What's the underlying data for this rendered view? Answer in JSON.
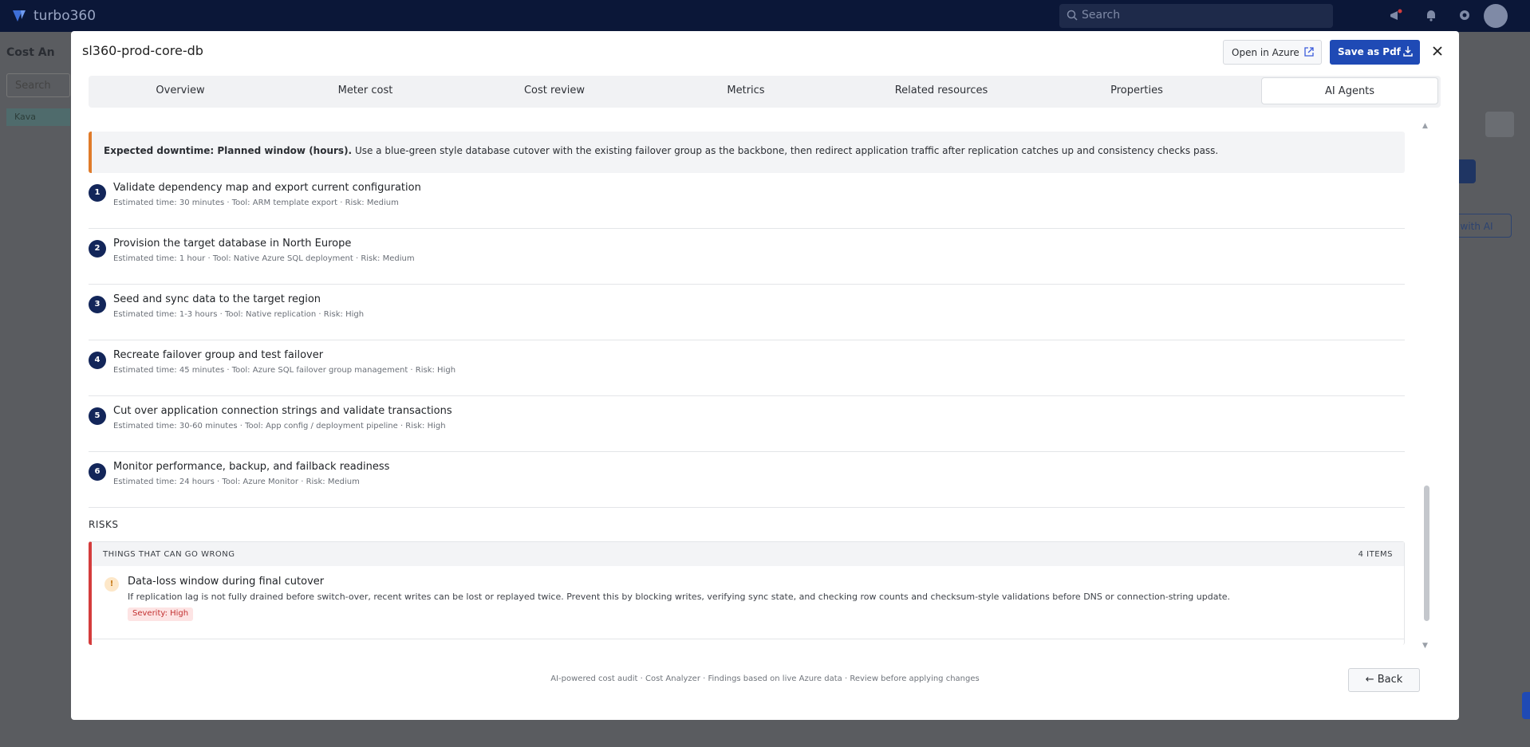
{
  "app": {
    "name": "turbo360",
    "search_placeholder": "Search",
    "bg_page_title": "Cost An",
    "bg_search_placeholder": "Search",
    "bg_tree_item": "Kava",
    "bg_ai_button": "t with AI"
  },
  "modal": {
    "title": "sl360-prod-core-db",
    "open_azure_label": "Open in Azure",
    "save_pdf_label": "Save as Pdf",
    "close_icon": "close-icon"
  },
  "tabs": [
    {
      "label": "Overview"
    },
    {
      "label": "Meter cost"
    },
    {
      "label": "Cost review"
    },
    {
      "label": "Metrics"
    },
    {
      "label": "Related resources"
    },
    {
      "label": "Properties"
    },
    {
      "label": "AI Agents",
      "active": true
    }
  ],
  "downtime": {
    "label": "Expected downtime: Planned window (hours).",
    "text": "Use a blue-green style database cutover with the existing failover group as the backbone, then redirect application traffic after replication catches up and consistency checks pass."
  },
  "steps": [
    {
      "num": "1",
      "title": "Validate dependency map and export current configuration",
      "meta": "Estimated time: 30 minutes · Tool: ARM template export · Risk: Medium"
    },
    {
      "num": "2",
      "title": "Provision the target database in North Europe",
      "meta": "Estimated time: 1 hour · Tool: Native Azure SQL deployment · Risk: Medium"
    },
    {
      "num": "3",
      "title": "Seed and sync data to the target region",
      "meta": "Estimated time: 1-3 hours · Tool: Native replication · Risk: High"
    },
    {
      "num": "4",
      "title": "Recreate failover group and test failover",
      "meta": "Estimated time: 45 minutes · Tool: Azure SQL failover group management · Risk: High"
    },
    {
      "num": "5",
      "title": "Cut over application connection strings and validate transactions",
      "meta": "Estimated time: 30-60 minutes · Tool: App config / deployment pipeline · Risk: High"
    },
    {
      "num": "6",
      "title": "Monitor performance, backup, and failback readiness",
      "meta": "Estimated time: 24 hours · Tool: Azure Monitor · Risk: Medium"
    }
  ],
  "risks": {
    "section_label": "RISKS",
    "header_title": "THINGS THAT CAN GO WRONG",
    "header_count": "4 ITEMS",
    "items": [
      {
        "icon": "!",
        "title": "Data-loss window during final cutover",
        "description": "If replication lag is not fully drained before switch-over, recent writes can be lost or replayed twice. Prevent this by blocking writes, verifying sync state, and checking row counts and checksum-style validations before DNS or connection-string update.",
        "severity": "Severity: High"
      }
    ]
  },
  "footer": {
    "note": "AI-powered cost audit · Cost Analyzer · Findings based on live Azure data · Review before applying changes",
    "back_label": "Back"
  },
  "colors": {
    "accent": "#1f4ab5",
    "step_badge": "#13265a",
    "downtime_border": "#e07b2a",
    "risk_border": "#d43c3c"
  }
}
